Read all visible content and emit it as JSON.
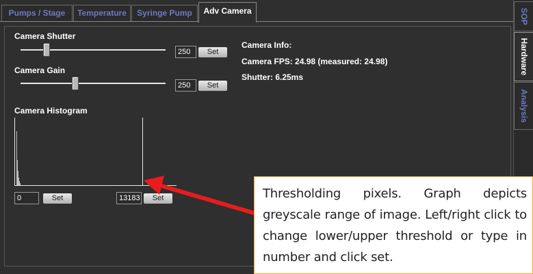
{
  "tabs": [
    {
      "label": "Pumps / Stage"
    },
    {
      "label": "Temperature"
    },
    {
      "label": "Syringe Pump"
    },
    {
      "label": "Adv Camera"
    }
  ],
  "side_tabs": [
    {
      "label": "SOP"
    },
    {
      "label": "Hardware"
    },
    {
      "label": "Analysis"
    }
  ],
  "shutter": {
    "label": "Camera Shutter",
    "value": "250",
    "set_label": "Set",
    "slider_level_percent": 18
  },
  "gain": {
    "label": "Camera Gain",
    "value": "250",
    "set_label": "Set",
    "slider_level_percent": 38
  },
  "info": {
    "title": "Camera Info:",
    "fps": "Camera FPS: 24.98 (measured: 24.98)",
    "shutter": "Shutter: 6.25ms"
  },
  "histogram": {
    "label": "Camera Histogram",
    "lower_value": "0",
    "upper_value": "13183",
    "set_label": "Set"
  },
  "annotation": {
    "text": "Thresholding pixels. Graph depicts greyscale range of image. Left/right click to change lower/upper threshold or type in number and click set."
  },
  "colors": {
    "arrow": "#e81c1c",
    "callout_border": "#f2a93b",
    "tab_inactive_text": "#6f79c2"
  }
}
